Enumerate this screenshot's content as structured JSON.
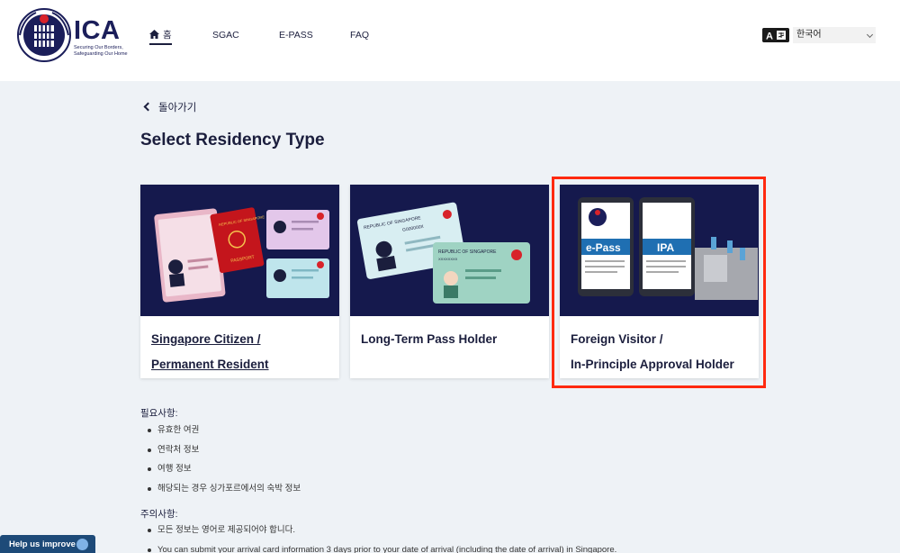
{
  "header": {
    "logo_text": "ICA",
    "logo_tagline": "Securing Our Borders, Safeguarding Our Home",
    "nav": [
      {
        "label": "홈",
        "active": true
      },
      {
        "label": "SGAC",
        "active": false
      },
      {
        "label": "E-PASS",
        "active": false
      },
      {
        "label": "FAQ",
        "active": false
      }
    ],
    "language": {
      "selected": "한국어",
      "icon": "translate-icon"
    }
  },
  "main": {
    "back_label": "돌아가기",
    "title": "Select Residency Type",
    "cards": [
      {
        "line1": "Singapore Citizen /",
        "line2": "Permanent Resident",
        "underlined": true,
        "selected": false
      },
      {
        "line1": "Long-Term Pass Holder",
        "line2": "",
        "underlined": false,
        "selected": false
      },
      {
        "line1": "Foreign Visitor /",
        "line2": "In-Principle Approval Holder",
        "underlined": false,
        "selected": true
      }
    ],
    "card_art": {
      "passport_cover": "REPUBLIC OF SINGAPORE",
      "passport_label": "PASSPORT",
      "ltp_card_title": "REPUBLIC OF SINGAPORE",
      "ltp_card_fin": "G000000X",
      "ltp_card_fin2": "XXXXXXXX",
      "phone1_label": "e-Pass",
      "phone2_label": "IPA"
    },
    "requirements": {
      "title": "필요사항:",
      "items": [
        "유효한 여권",
        "연락처 정보",
        "여행 정보",
        "해당되는 경우 싱가포르에서의 숙박 정보"
      ]
    },
    "notes": {
      "title": "주의사항:",
      "items": [
        "모든 정보는 영어로 제공되어야 합니다.",
        "You can submit your arrival card information 3 days prior to your date of arrival (including the date of arrival) in Singapore."
      ]
    }
  },
  "help_button": "Help us improve",
  "colors": {
    "navy": "#15194d",
    "highlight": "#ff2a10",
    "help_bg": "#1d4a78"
  }
}
